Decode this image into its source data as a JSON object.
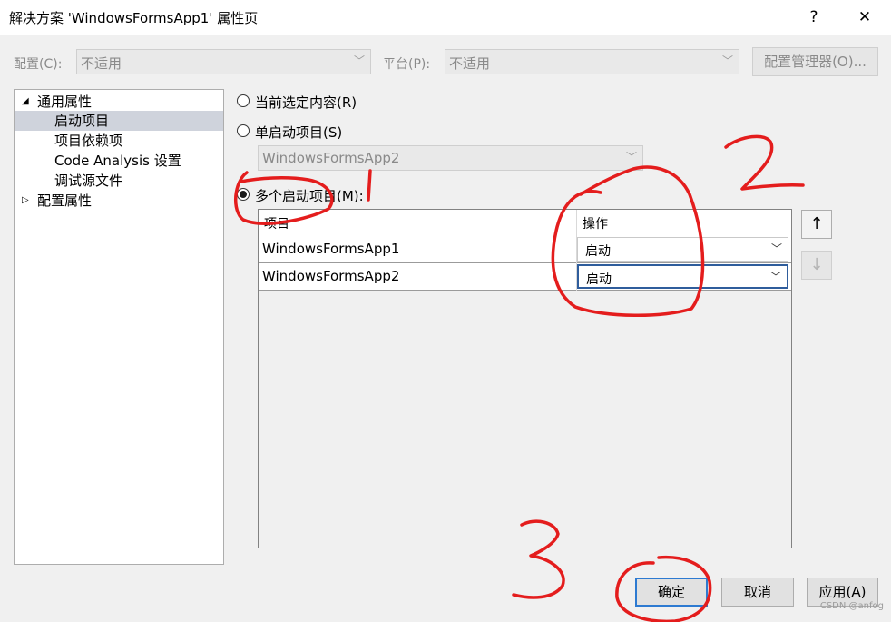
{
  "window": {
    "title": "解决方案 'WindowsFormsApp1' 属性页",
    "help_label": "?",
    "close_label": "✕"
  },
  "config_bar": {
    "config_label": "配置(C):",
    "config_value": "不适用",
    "platform_label": "平台(P):",
    "platform_value": "不适用",
    "manager_button": "配置管理器(O)..."
  },
  "tree": {
    "common_props": "通用属性",
    "items": [
      "启动项目",
      "项目依赖项",
      "Code Analysis 设置",
      "调试源文件"
    ],
    "config_props": "配置属性",
    "expanded_glyph": "◢",
    "collapsed_glyph": "▷"
  },
  "startup": {
    "current_selection": "当前选定内容(R)",
    "single_startup": "单启动项目(S)",
    "single_value": "WindowsFormsApp2",
    "multiple_startup": "多个启动项目(M):",
    "selected_option": "multiple"
  },
  "grid": {
    "col_project": "项目",
    "col_action": "操作",
    "rows": [
      {
        "project": "WindowsFormsApp1",
        "action": "启动"
      },
      {
        "project": "WindowsFormsApp2",
        "action": "启动"
      }
    ],
    "move_up": "↑",
    "move_down": "↓"
  },
  "buttons": {
    "ok": "确定",
    "cancel": "取消",
    "apply": "应用(A)"
  },
  "watermark": "CSDN @anfog",
  "annotations": {
    "color": "#e41d1d",
    "labels": [
      "1",
      "2",
      "3"
    ]
  }
}
